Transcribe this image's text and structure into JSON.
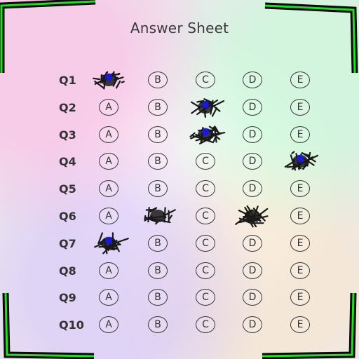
{
  "title": "Answer Sheet",
  "options": [
    "A",
    "B",
    "C",
    "D",
    "E"
  ],
  "questions": [
    {
      "label": "Q1",
      "filled": "A",
      "detected": "A"
    },
    {
      "label": "Q2",
      "filled": "C",
      "detected": "C"
    },
    {
      "label": "Q3",
      "filled": "C",
      "detected": "C"
    },
    {
      "label": "Q4",
      "filled": "E",
      "detected": "E"
    },
    {
      "label": "Q5",
      "filled": null,
      "detected": null
    },
    {
      "label": "Q6",
      "filled": "B",
      "detected": null
    },
    {
      "label": "Q7",
      "filled": "A",
      "detected": "A"
    },
    {
      "label": "Q8",
      "filled": null,
      "detected": null
    },
    {
      "label": "Q9",
      "filled": null,
      "detected": null
    },
    {
      "label": "Q10",
      "filled": null,
      "detected": null
    }
  ],
  "extra_marks": [
    {
      "question": "Q6",
      "option": "D",
      "detected": false
    }
  ],
  "colors": {
    "corner": "#22dd22",
    "detection_dot": "#1a1ad0",
    "ink": "#1a1a1a"
  }
}
